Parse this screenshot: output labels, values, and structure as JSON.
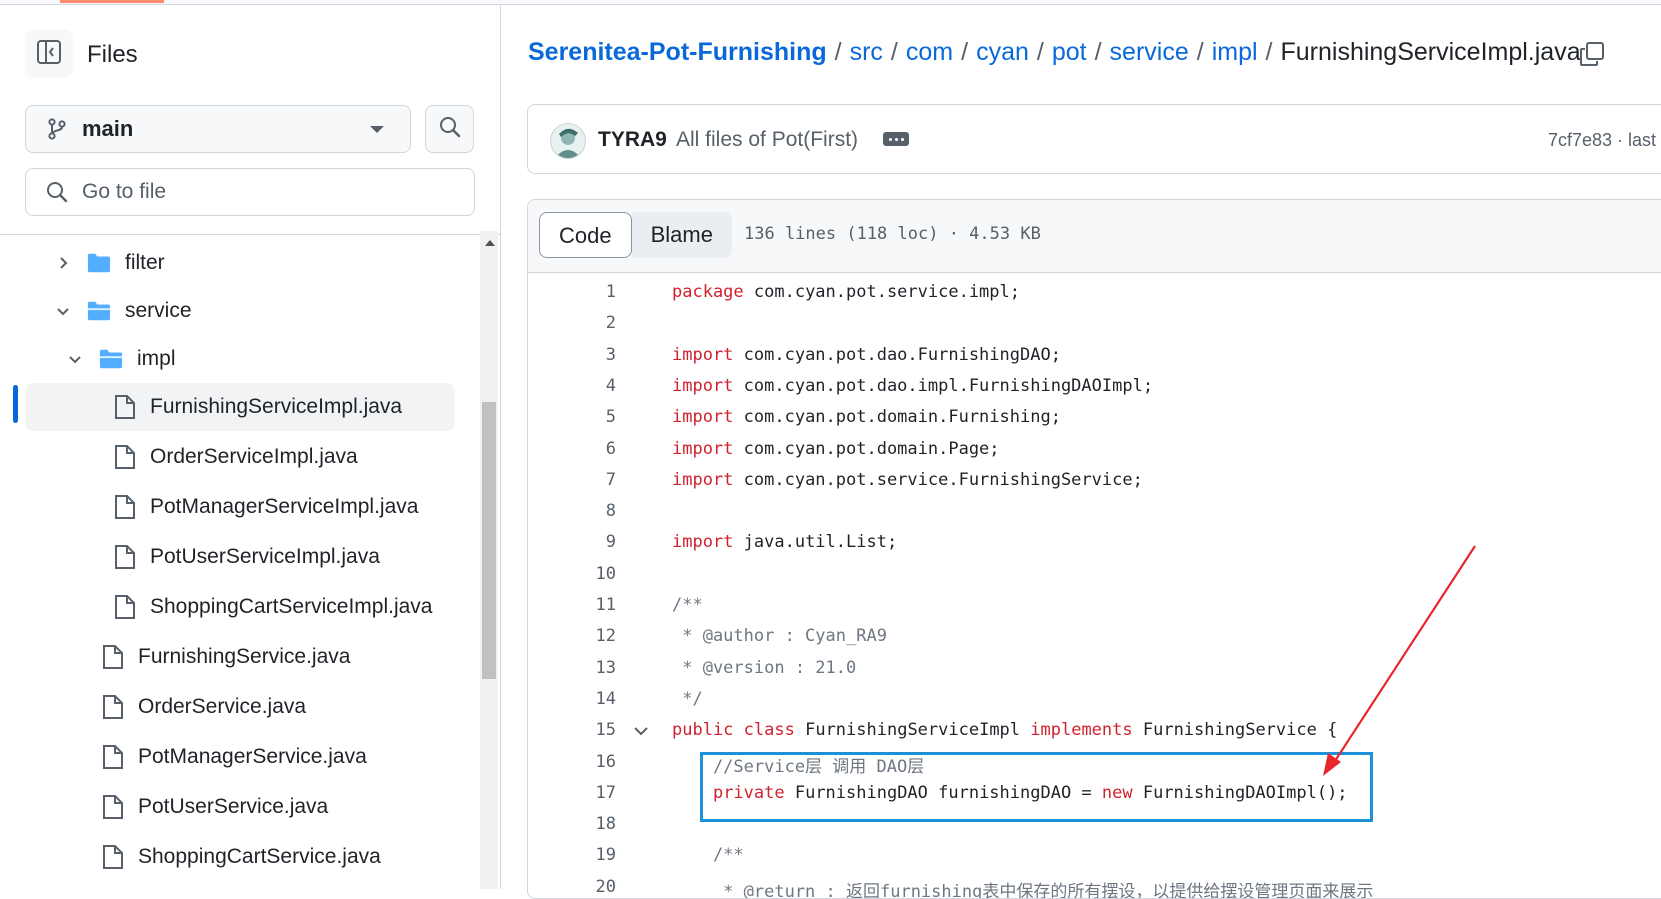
{
  "sidebar": {
    "title": "Files",
    "branch": "main",
    "goto_placeholder": "Go to file",
    "tree": [
      {
        "label": "filter",
        "type": "folder",
        "state": "collapsed"
      },
      {
        "label": "service",
        "type": "folder",
        "state": "expanded"
      },
      {
        "label": "impl",
        "type": "folder",
        "state": "expanded"
      },
      {
        "label": "FurnishingServiceImpl.java",
        "type": "file",
        "active": true
      },
      {
        "label": "OrderServiceImpl.java",
        "type": "file"
      },
      {
        "label": "PotManagerServiceImpl.java",
        "type": "file"
      },
      {
        "label": "PotUserServiceImpl.java",
        "type": "file"
      },
      {
        "label": "ShoppingCartServiceImpl.java",
        "type": "file"
      },
      {
        "label": "FurnishingService.java",
        "type": "file"
      },
      {
        "label": "OrderService.java",
        "type": "file"
      },
      {
        "label": "PotManagerService.java",
        "type": "file"
      },
      {
        "label": "PotUserService.java",
        "type": "file"
      },
      {
        "label": "ShoppingCartService.java",
        "type": "file"
      }
    ]
  },
  "breadcrumb": {
    "repo": "Serenitea-Pot-Furnishing",
    "parts": [
      "src",
      "com",
      "cyan",
      "pot",
      "service",
      "impl"
    ],
    "file": "FurnishingServiceImpl.java",
    "separator": "/"
  },
  "commit": {
    "author": "TYRA9",
    "message": "All files of Pot(First)",
    "hash_text": "7cf7e83 · last"
  },
  "file": {
    "tab_code": "Code",
    "tab_blame": "Blame",
    "info": "136 lines (118 loc) · 4.53 KB"
  },
  "code_lines": [
    {
      "n": "1",
      "kw": "package",
      "rest": " com.cyan.pot.service.impl;"
    },
    {
      "n": "2",
      "kw": "",
      "rest": ""
    },
    {
      "n": "3",
      "kw": "import",
      "rest": " com.cyan.pot.dao.FurnishingDAO;"
    },
    {
      "n": "4",
      "kw": "import",
      "rest": " com.cyan.pot.dao.impl.FurnishingDAOImpl;"
    },
    {
      "n": "5",
      "kw": "import",
      "rest": " com.cyan.pot.domain.Furnishing;"
    },
    {
      "n": "6",
      "kw": "import",
      "rest": " com.cyan.pot.domain.Page;"
    },
    {
      "n": "7",
      "kw": "import",
      "rest": " com.cyan.pot.service.FurnishingService;"
    },
    {
      "n": "8",
      "kw": "",
      "rest": ""
    },
    {
      "n": "9",
      "kw": "import",
      "rest": " java.util.List;"
    },
    {
      "n": "10",
      "kw": "",
      "rest": ""
    },
    {
      "n": "11",
      "comment": "/**"
    },
    {
      "n": "12",
      "comment": " * @author : Cyan_RA9"
    },
    {
      "n": "13",
      "comment": " * @version : 21.0"
    },
    {
      "n": "14",
      "comment": " */"
    },
    {
      "n": "15",
      "fold": true,
      "segments": [
        {
          "t": "public",
          "k": true
        },
        {
          "t": " "
        },
        {
          "t": "class",
          "k": true
        },
        {
          "t": " FurnishingServiceImpl "
        },
        {
          "t": "implements",
          "k": true
        },
        {
          "t": " FurnishingService {"
        }
      ]
    },
    {
      "n": "16",
      "comment": "    //Service层 调用 DAO层"
    },
    {
      "n": "17",
      "segments": [
        {
          "t": "    "
        },
        {
          "t": "private",
          "k": true
        },
        {
          "t": " FurnishingDAO furnishingDAO = "
        },
        {
          "t": "new",
          "k": true
        },
        {
          "t": " FurnishingDAOImpl();"
        }
      ]
    },
    {
      "n": "18",
      "kw": "",
      "rest": ""
    },
    {
      "n": "19",
      "comment": "    /**"
    },
    {
      "n": "20",
      "comment": "     * @return : 返回furnishing表中保存的所有摆设，以提供给摆设管理页面来展示"
    }
  ],
  "colors": {
    "link": "#0969da",
    "keyword": "#cf222e",
    "comment": "#6e7781",
    "highlight_box": "#1e90d8",
    "annotation_arrow": "#e8262b",
    "active_indicator": "#0969da"
  }
}
